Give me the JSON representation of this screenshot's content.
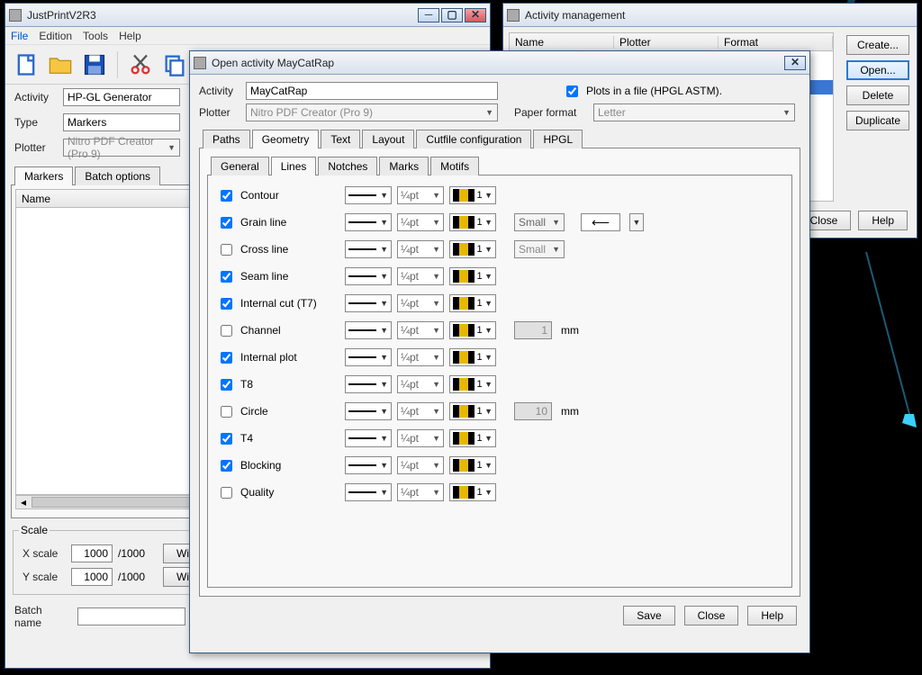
{
  "main": {
    "title": "JustPrintV2R3",
    "menu": [
      "File",
      "Edition",
      "Tools",
      "Help"
    ],
    "activity_label": "Activity",
    "activity_value": "HP-GL Generator",
    "type_label": "Type",
    "type_value": "Markers",
    "plotter_label": "Plotter",
    "plotter_value": "Nitro PDF Creator (Pro 9)",
    "tabs": {
      "markers": "Markers",
      "batch": "Batch options"
    },
    "name_col": "Name",
    "scale": {
      "title": "Scale",
      "xlabel": "X scale",
      "ylabel": "Y scale",
      "xval": "1000",
      "yval": "1000",
      "denom": "/1000",
      "wizard": "Wizar"
    },
    "batch_label": "Batch name"
  },
  "mgmt": {
    "title": "Activity management",
    "cols": {
      "name": "Name",
      "plotter": "Plotter",
      "format": "Format"
    },
    "buttons": {
      "create": "Create...",
      "open": "Open...",
      "del": "Delete",
      "dup": "Duplicate",
      "close": "Close",
      "help": "Help"
    }
  },
  "dlg": {
    "title": "Open activity MayCatRap",
    "activity_label": "Activity",
    "activity_value": "MayCatRap",
    "plots_label": "Plots in a file (HPGL ASTM).",
    "plotter_label": "Plotter",
    "plotter_value": "Nitro PDF Creator (Pro 9)",
    "paper_label": "Paper format",
    "paper_value": "Letter",
    "maintabs": [
      "Paths",
      "Geometry",
      "Text",
      "Layout",
      "Cutfile configuration",
      "HPGL"
    ],
    "subtabs": [
      "General",
      "Lines",
      "Notches",
      "Marks",
      "Motifs"
    ],
    "width_text": "¼pt",
    "colnum": "1",
    "small": "Small",
    "mm": "mm",
    "rows": [
      {
        "label": "Contour",
        "chk": true
      },
      {
        "label": "Grain line",
        "chk": true,
        "extra": "small_arrow"
      },
      {
        "label": "Cross line",
        "chk": false,
        "extra": "small_dis"
      },
      {
        "label": "Seam line",
        "chk": true
      },
      {
        "label": "Internal cut (T7)",
        "chk": true
      },
      {
        "label": "Channel",
        "chk": false,
        "size": "1"
      },
      {
        "label": "Internal plot",
        "chk": true
      },
      {
        "label": "T8",
        "chk": true
      },
      {
        "label": "Circle",
        "chk": false,
        "size": "10"
      },
      {
        "label": "T4",
        "chk": true
      },
      {
        "label": "Blocking",
        "chk": true
      },
      {
        "label": "Quality",
        "chk": false
      }
    ],
    "buttons": {
      "save": "Save",
      "close": "Close",
      "help": "Help"
    }
  }
}
